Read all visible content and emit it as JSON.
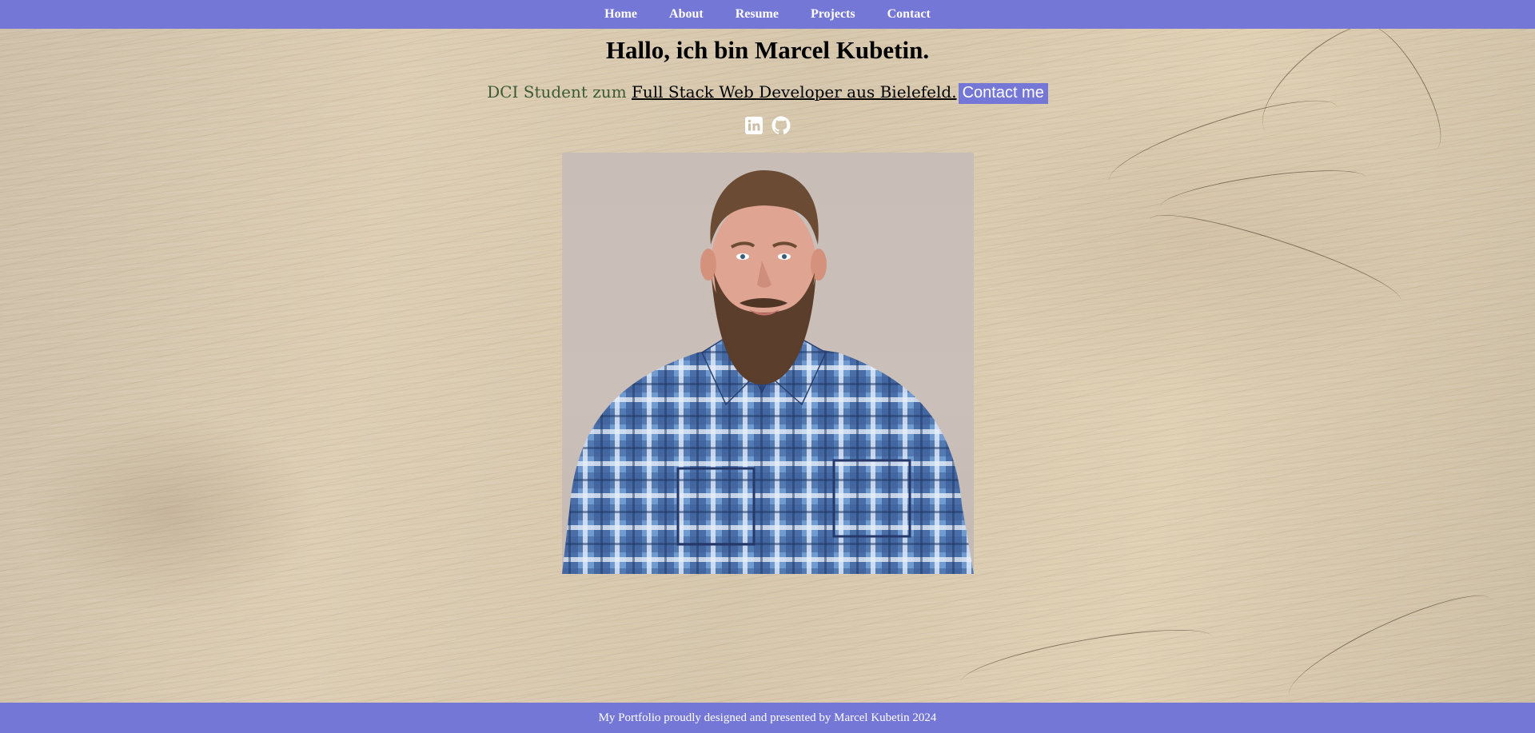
{
  "nav": {
    "items": [
      {
        "label": "Home"
      },
      {
        "label": "About"
      },
      {
        "label": "Resume"
      },
      {
        "label": "Projects"
      },
      {
        "label": "Contact"
      }
    ]
  },
  "hero": {
    "title": "Hallo, ich bin Marcel Kubetin.",
    "subtitle_prefix": "DCI Student zum",
    "subtitle_link": "Full Stack Web Developer aus Bielefeld.",
    "contact_button": "Contact me"
  },
  "socials": [
    {
      "icon": "linkedin-icon"
    },
    {
      "icon": "github-icon"
    }
  ],
  "colors": {
    "nav_bg": "#7577d6",
    "accent_green": "#3c5a35"
  },
  "footer": {
    "text": "My Portfolio proudly designed and presented by Marcel Kubetin 2024"
  }
}
